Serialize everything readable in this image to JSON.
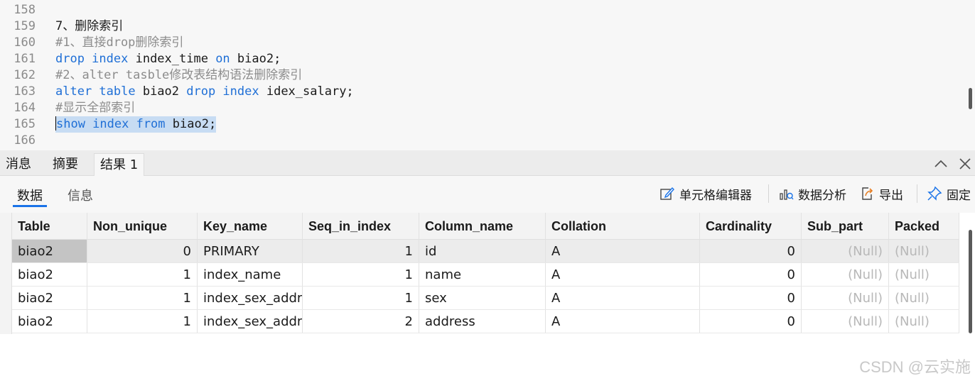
{
  "editor": {
    "lines": [
      {
        "num": "158",
        "parts": []
      },
      {
        "num": "159",
        "parts": [
          {
            "t": "txt",
            "v": "7、删除索引"
          }
        ]
      },
      {
        "num": "160",
        "parts": [
          {
            "t": "cmt",
            "v": "#1、直接drop删除索引"
          }
        ]
      },
      {
        "num": "161",
        "parts": [
          {
            "t": "kw",
            "v": "drop index"
          },
          {
            "t": "txt",
            "v": " index_time "
          },
          {
            "t": "kw",
            "v": "on"
          },
          {
            "t": "txt",
            "v": " biao2;"
          }
        ]
      },
      {
        "num": "162",
        "parts": [
          {
            "t": "cmt",
            "v": "#2、alter tasble修改表结构语法删除索引"
          }
        ]
      },
      {
        "num": "163",
        "parts": [
          {
            "t": "kw",
            "v": "alter table"
          },
          {
            "t": "txt",
            "v": " biao2 "
          },
          {
            "t": "kw",
            "v": "drop index"
          },
          {
            "t": "txt",
            "v": " idex_salary;"
          }
        ]
      },
      {
        "num": "164",
        "parts": [
          {
            "t": "cmt",
            "v": "#显示全部索引"
          }
        ]
      },
      {
        "num": "165",
        "selected": true,
        "parts": [
          {
            "t": "kw",
            "v": "show index from"
          },
          {
            "t": "txt",
            "v": " biao2;"
          }
        ]
      },
      {
        "num": "166",
        "parts": []
      }
    ]
  },
  "result_tabs": [
    {
      "label": "消息",
      "active": false
    },
    {
      "label": "摘要",
      "active": false
    },
    {
      "label": "结果 1",
      "active": true
    }
  ],
  "sub_tabs": [
    {
      "label": "数据",
      "active": true
    },
    {
      "label": "信息",
      "active": false
    }
  ],
  "toolbar": {
    "cell_editor": "单元格编辑器",
    "data_analysis": "数据分析",
    "export": "导出",
    "pin": "固定"
  },
  "table": {
    "columns": [
      "Table",
      "Non_unique",
      "Key_name",
      "Seq_in_index",
      "Column_name",
      "Collation",
      "Cardinality",
      "Sub_part",
      "Packed"
    ],
    "rows": [
      [
        "biao2",
        "0",
        "PRIMARY",
        "1",
        "id",
        "A",
        "0",
        "(Null)",
        "(Null)"
      ],
      [
        "biao2",
        "1",
        "index_name",
        "1",
        "name",
        "A",
        "0",
        "(Null)",
        "(Null)"
      ],
      [
        "biao2",
        "1",
        "index_sex_addr",
        "1",
        "sex",
        "A",
        "0",
        "(Null)",
        "(Null)"
      ],
      [
        "biao2",
        "1",
        "index_sex_addr",
        "2",
        "address",
        "A",
        "0",
        "(Null)",
        "(Null)"
      ]
    ]
  },
  "watermark": "CSDN @云实施",
  "colors": {
    "keyword": "#1f6fd6",
    "comment": "#8c8c8c",
    "selection": "#c7dcf3",
    "accent": "#1a73e8"
  }
}
